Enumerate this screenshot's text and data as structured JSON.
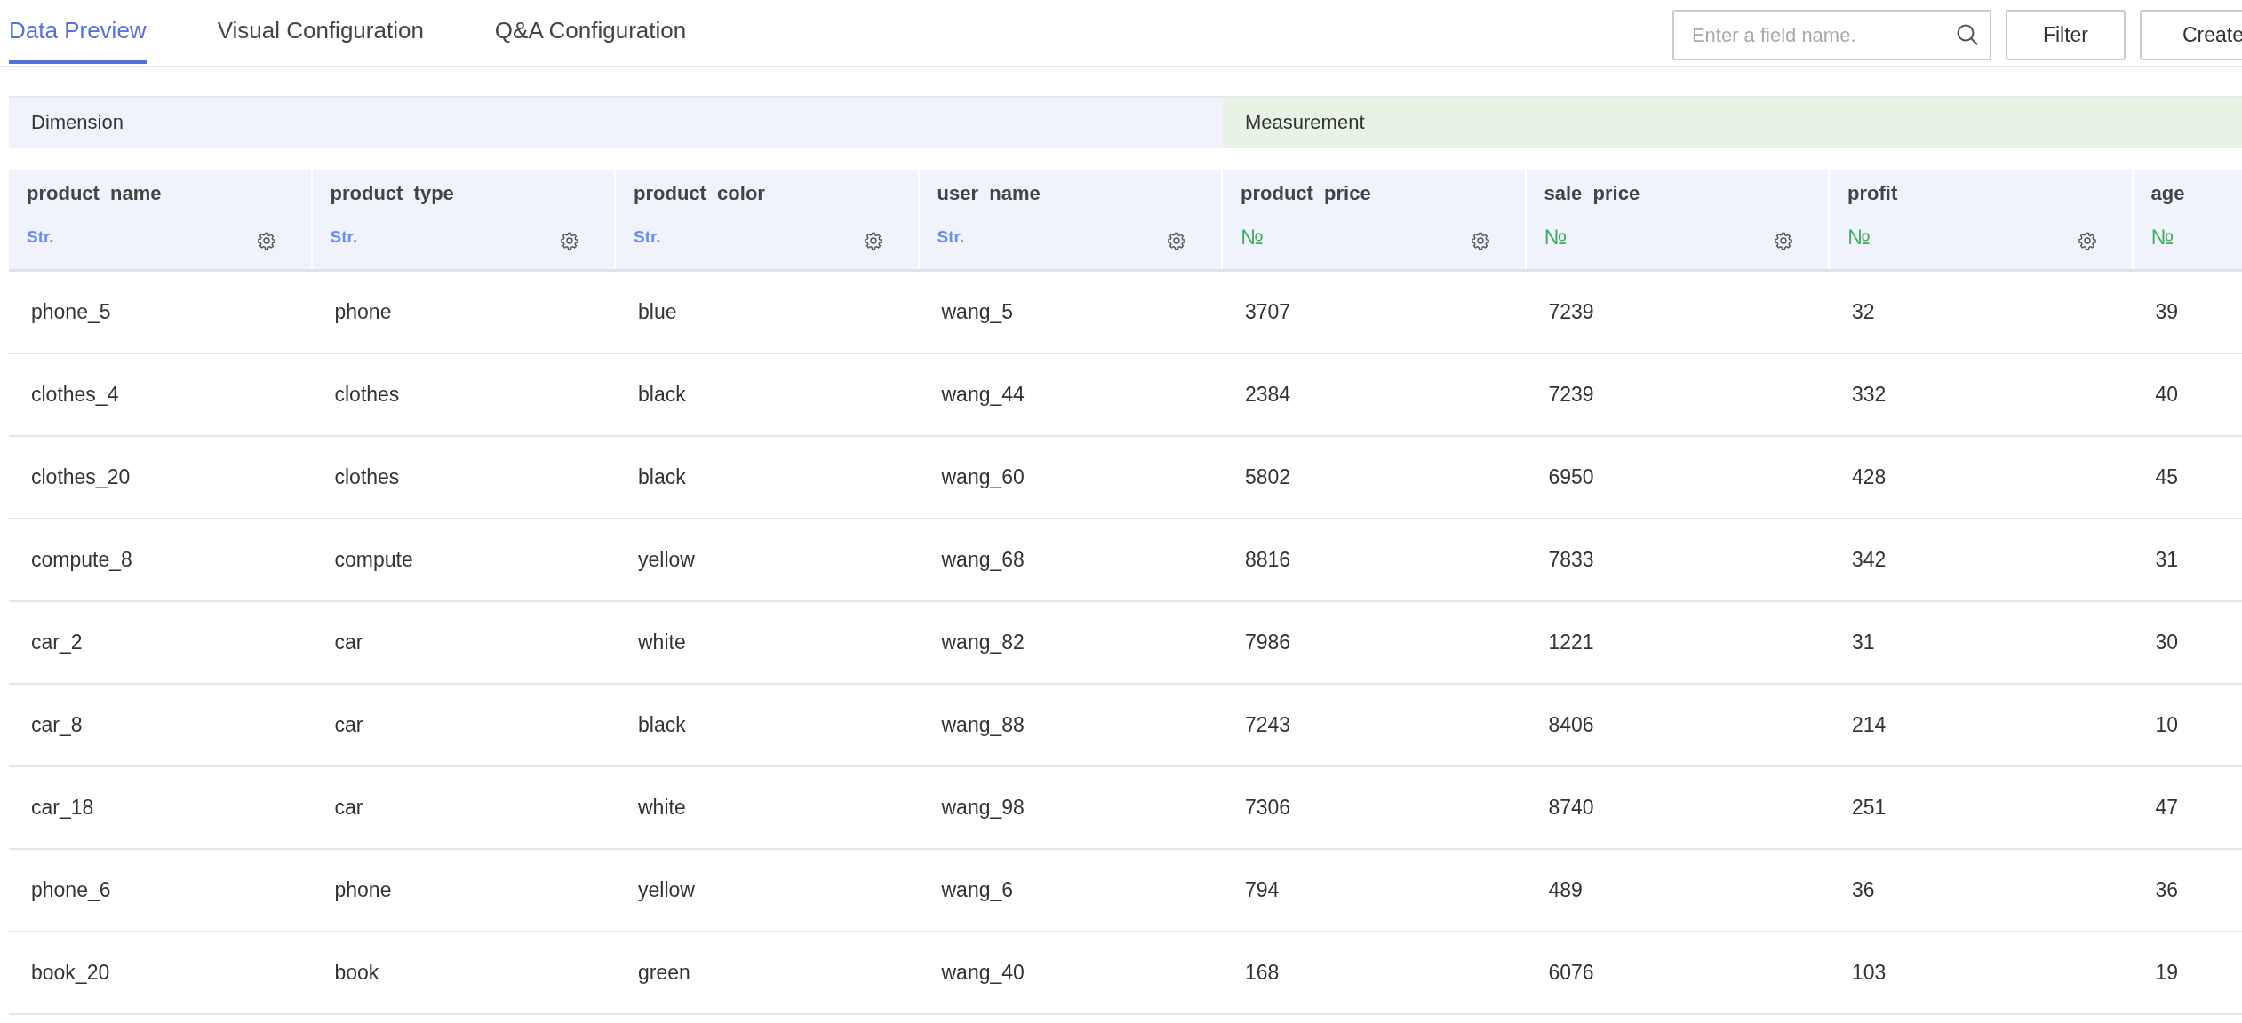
{
  "tabs": [
    {
      "label": "Data Preview",
      "selected": true
    },
    {
      "label": "Visual Configuration",
      "selected": false
    },
    {
      "label": "Q&A Configuration",
      "selected": false
    }
  ],
  "search": {
    "placeholder": "Enter a field name."
  },
  "buttons": [
    "Filter",
    "Create"
  ],
  "table": {
    "groups": [
      {
        "label": "Dimension",
        "kind": "dimension",
        "columns": [
          {
            "name": "product_name",
            "type": "Str.",
            "gear": true
          },
          {
            "name": "product_type",
            "type": "Str.",
            "gear": true
          },
          {
            "name": "product_color",
            "type": "Str.",
            "gear": true
          },
          {
            "name": "user_name",
            "type": "Str.",
            "gear": true
          }
        ]
      },
      {
        "label": "Measurement",
        "kind": "measurement",
        "columns": [
          {
            "name": "product_price",
            "type": "№",
            "gear": true
          },
          {
            "name": "sale_price",
            "type": "№",
            "gear": true
          },
          {
            "name": "profit",
            "type": "№",
            "gear": true
          },
          {
            "name": "age",
            "type": "№",
            "gear": false
          }
        ]
      }
    ],
    "rows": [
      [
        "phone_5",
        "phone",
        "blue",
        "wang_5",
        "3707",
        "7239",
        "32",
        "39"
      ],
      [
        "clothes_4",
        "clothes",
        "black",
        "wang_44",
        "2384",
        "7239",
        "332",
        "40"
      ],
      [
        "clothes_20",
        "clothes",
        "black",
        "wang_60",
        "5802",
        "6950",
        "428",
        "45"
      ],
      [
        "compute_8",
        "compute",
        "yellow",
        "wang_68",
        "8816",
        "7833",
        "342",
        "31"
      ],
      [
        "car_2",
        "car",
        "white",
        "wang_82",
        "7986",
        "1221",
        "31",
        "30"
      ],
      [
        "car_8",
        "car",
        "black",
        "wang_88",
        "7243",
        "8406",
        "214",
        "10"
      ],
      [
        "car_18",
        "car",
        "white",
        "wang_98",
        "7306",
        "8740",
        "251",
        "47"
      ],
      [
        "phone_6",
        "phone",
        "yellow",
        "wang_6",
        "794",
        "489",
        "36",
        "36"
      ],
      [
        "book_20",
        "book",
        "green",
        "wang_40",
        "168",
        "6076",
        "103",
        "19"
      ]
    ]
  }
}
